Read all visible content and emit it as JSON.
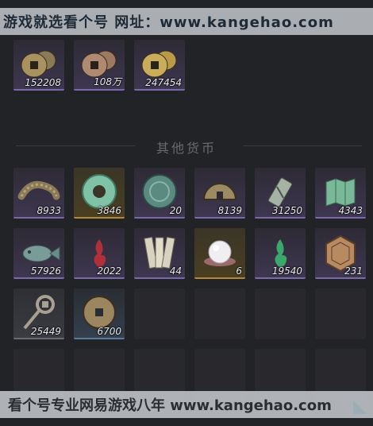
{
  "banners": {
    "top": "游戏就选看个号  网址：www.kangehao.com",
    "bottom": "看个号专业网易游戏八年  www.kangehao.com"
  },
  "section": {
    "title": "其他货币"
  },
  "top_row": [
    {
      "icon": "copper-coins-stack-icon",
      "count": "152208",
      "rarity": "purple"
    },
    {
      "icon": "copper-coins-pile-icon",
      "count": "108万",
      "rarity": "purple"
    },
    {
      "icon": "gold-coins-icon",
      "count": "247454",
      "rarity": "purple"
    }
  ],
  "grid": [
    {
      "icon": "bronze-bracelet-icon",
      "count": "8933",
      "rarity": "purple"
    },
    {
      "icon": "jade-disc-icon",
      "count": "3846",
      "rarity": "gold"
    },
    {
      "icon": "jade-pendant-icon",
      "count": "20",
      "rarity": "purple"
    },
    {
      "icon": "half-coin-icon",
      "count": "8139",
      "rarity": "purple"
    },
    {
      "icon": "jade-token-icon",
      "count": "31250",
      "rarity": "purple"
    },
    {
      "icon": "map-scroll-icon",
      "count": "4343",
      "rarity": "purple"
    },
    {
      "icon": "jade-fish-icon",
      "count": "57926",
      "rarity": "purple"
    },
    {
      "icon": "red-flame-icon",
      "count": "2022",
      "rarity": "purple"
    },
    {
      "icon": "paper-talismans-icon",
      "count": "44",
      "rarity": "purple"
    },
    {
      "icon": "pearl-icon",
      "count": "6",
      "rarity": "gold"
    },
    {
      "icon": "green-flame-icon",
      "count": "19540",
      "rarity": "purple"
    },
    {
      "icon": "bronze-plaque-icon",
      "count": "231",
      "rarity": "purple"
    },
    {
      "icon": "coin-key-icon",
      "count": "25449",
      "rarity": "gray"
    },
    {
      "icon": "copper-coin-icon",
      "count": "6700",
      "rarity": "blue"
    }
  ]
}
